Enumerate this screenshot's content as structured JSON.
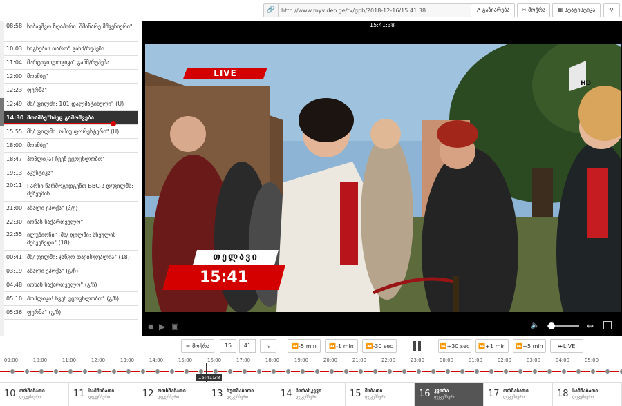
{
  "topbar": {
    "url": "http://www.myvideo.ge/tv/gpb/2018-12-16/15:41:38",
    "share_label": "გაზიარება",
    "cut_label": "მოჭრა",
    "schedule_label": "სტატისტიკა"
  },
  "programs": [
    {
      "time": "08:58",
      "name": "საბავშვო ზღაპარი: შმინარე მშვენიერი\"",
      "tall": true
    },
    {
      "time": "10:03",
      "name": "ნიგნების თარო\" განმ/რეპეზა"
    },
    {
      "time": "11:04",
      "name": "მარტივი ლოგიკა\" განმ/რეპეზა"
    },
    {
      "time": "12:00",
      "name": "მოამბე\""
    },
    {
      "time": "12:23",
      "name": "ფერმა\""
    },
    {
      "time": "12:49",
      "name": "მხ/ ფილმი: 101 დალმატინელი\" (U)"
    },
    {
      "time": "14:30",
      "name": "მოამბე\"სპეც გამოშვება",
      "active": true,
      "progress": 0.82
    },
    {
      "time": "15:55",
      "name": "მხ/ ფილმი: ოპიუ ფორესტერი\" (U)"
    },
    {
      "time": "18:00",
      "name": "მოამბე\""
    },
    {
      "time": "18:47",
      "name": "პოპლიკა! ჩვენ ვცოცხლობთ\""
    },
    {
      "time": "19:13",
      "name": "აკუსტიკა\""
    },
    {
      "time": "20:11",
      "name": "I არხი წარმოგიდგენთ BBC-ს დ/ფილმს: მუზეუმის",
      "tall": true
    },
    {
      "time": "21:00",
      "name": "ახალი ეპოქა\" (პ/ე)"
    },
    {
      "time": "22:30",
      "name": "იონას საქართველო\""
    },
    {
      "time": "22:55",
      "name": "ილუზიონი\" -მხ/ ფილმი: სხეულის მეშვეზედა\" (18)",
      "tall": true
    },
    {
      "time": "00:41",
      "name": "მხ/ ფილმი: ჯანგო თავისუფალია\" (18)"
    },
    {
      "time": "03:19",
      "name": "ახალი ეპოქა\" (გ/ჩ)"
    },
    {
      "time": "04:48",
      "name": "იონას საქართველო\" (გ/ჩ)"
    },
    {
      "time": "05:10",
      "name": "პოპლიკა! ჩვენ ვცოცხლობთ\" (გ/ჩ)"
    },
    {
      "time": "05:36",
      "name": "ფერმა\" (გ/ჩ)"
    }
  ],
  "player": {
    "clock": "15:41:38",
    "live_badge": "LIVE",
    "location_caption": "თელავი",
    "time_caption": "15:41",
    "hd_label": "HD"
  },
  "controls": {
    "cut_label": "მოჭრა",
    "hour": "15",
    "minute": "41",
    "go_symbol": "↳",
    "back5": "-5 min",
    "back1": "-1 min",
    "back30": "-30 sec",
    "fwd30": "+30 sec",
    "fwd1": "+1 min",
    "fwd5": "+5 min",
    "live": "LIVE"
  },
  "timeline": {
    "ticks": [
      "09:00",
      "10:00",
      "11:00",
      "12:00",
      "13:00",
      "14:00",
      "15:00",
      "16:00",
      "17:00",
      "18:00",
      "19:00",
      "20:00",
      "21:00",
      "22:00",
      "23:00",
      "00:00",
      "01:00",
      "02:00",
      "03:00",
      "04:00",
      "05:00"
    ],
    "current_time": "15:41:38"
  },
  "days": [
    {
      "num": "10",
      "name": "ორშაბათი",
      "month": "დეკემბერი"
    },
    {
      "num": "11",
      "name": "სამშაბათი",
      "month": "დეკემბერი"
    },
    {
      "num": "12",
      "name": "ოთხშაბათი",
      "month": "დეკემბერი"
    },
    {
      "num": "13",
      "name": "ხუთშაბათი",
      "month": "დეკემბერი"
    },
    {
      "num": "14",
      "name": "პარასკევი",
      "month": "დეკემბერი"
    },
    {
      "num": "15",
      "name": "შაბათი",
      "month": "დეკემბერი"
    },
    {
      "num": "16",
      "name": "კვირა",
      "month": "დეკემბერი",
      "active": true
    },
    {
      "num": "17",
      "name": "ორშაბათი",
      "month": "დეკემბერი"
    },
    {
      "num": "18",
      "name": "სამშაბათი",
      "month": "დეკემბერი"
    }
  ],
  "colors": {
    "accent": "#d40000",
    "dark": "#333333"
  }
}
